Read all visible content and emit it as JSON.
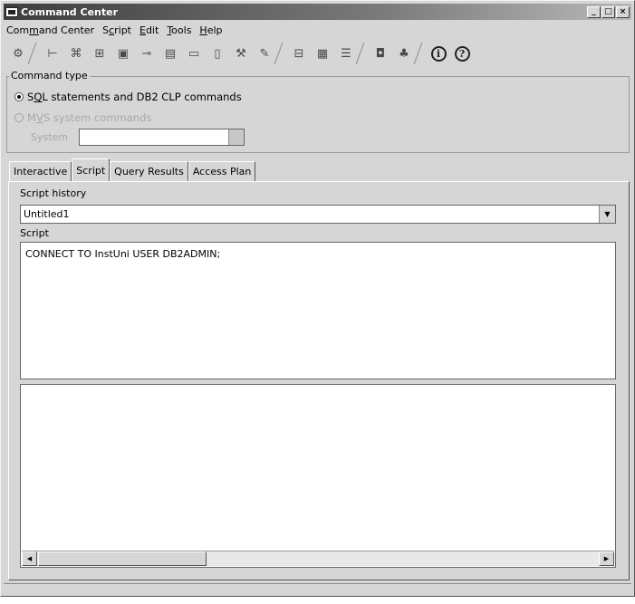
{
  "window": {
    "title": "Command Center"
  },
  "menu": [
    {
      "text": "Command Center",
      "u": "m",
      "pre": "Com",
      "post": "and Center"
    },
    {
      "text": "Script",
      "pre": "S",
      "u": "c",
      "post": "ript"
    },
    {
      "text": "Edit",
      "pre": "",
      "u": "E",
      "post": "dit"
    },
    {
      "text": "Tools",
      "pre": "",
      "u": "T",
      "post": "ools"
    },
    {
      "text": "Help",
      "pre": "",
      "u": "H",
      "post": "elp"
    }
  ],
  "toolbar": {
    "icons": [
      "settings-icon",
      "tree-icon",
      "network-icon",
      "hierarchy-icon",
      "database-icon",
      "link-icon",
      "document-icon",
      "monitor-icon",
      "page-icon",
      "tools-icon",
      "wizard-icon",
      "folder-tree-icon",
      "window-icon",
      "list-icon",
      "save-icon",
      "person-tree-icon",
      "info-icon",
      "help-icon"
    ],
    "info_glyph": "i",
    "help_glyph": "?"
  },
  "command_type": {
    "label": "Command type",
    "option_sql": {
      "pre": "S",
      "u": "Q",
      "post": "L statements and DB2 CLP commands",
      "selected": true
    },
    "option_mvs": {
      "pre": "M",
      "u": "V",
      "post": "S system commands",
      "selected": false,
      "enabled": false
    },
    "system_label": "System",
    "system_value": ""
  },
  "tabs": [
    {
      "label": "Interactive",
      "active": false
    },
    {
      "label": "Script",
      "active": true
    },
    {
      "label": "Query Results",
      "active": false
    },
    {
      "label": "Access Plan",
      "active": false
    }
  ],
  "script_tab": {
    "history_label": "Script history",
    "history_value": "Untitled1",
    "script_label": "Script",
    "script_text": "CONNECT TO InstUni USER DB2ADMIN;",
    "output_text": ""
  }
}
